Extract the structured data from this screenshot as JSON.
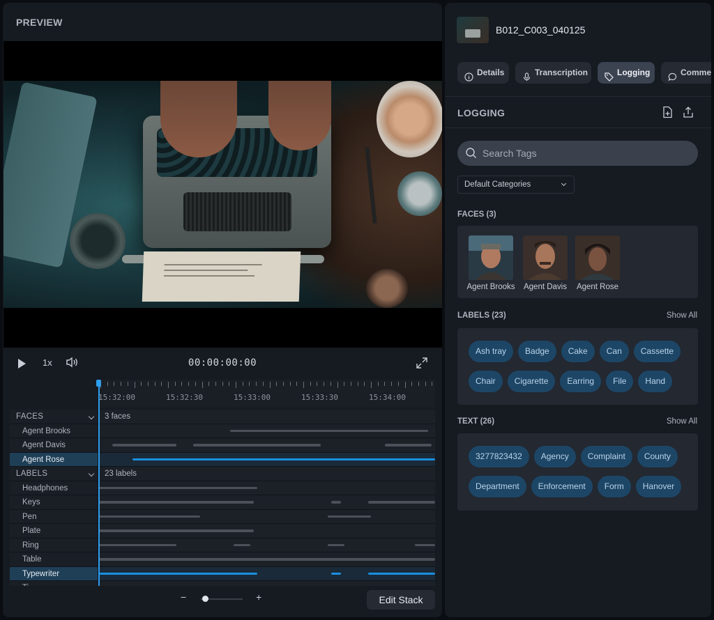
{
  "preview": {
    "title": "PREVIEW",
    "speed": "1x",
    "timecode": "00:00:00:00"
  },
  "timeline": {
    "ruler_labels": [
      "15:32:00",
      "15:32:30",
      "15:33:00",
      "15:33:30",
      "15:34:00"
    ],
    "rows": [
      {
        "type": "group",
        "name": "FACES",
        "count": "3 faces"
      },
      {
        "type": "sub",
        "name": "Agent Brooks",
        "segments": [
          [
            0.39,
            0.98
          ]
        ]
      },
      {
        "type": "sub",
        "name": "Agent Davis",
        "segments": [
          [
            0.04,
            0.23
          ],
          [
            0.28,
            0.66
          ],
          [
            0.85,
            0.99
          ]
        ]
      },
      {
        "type": "sub",
        "name": "Agent Rose",
        "selected": true,
        "segments": [
          [
            0.1,
            1.0
          ]
        ]
      },
      {
        "type": "group",
        "name": "LABELS",
        "count": "23 labels"
      },
      {
        "type": "sub",
        "name": "Headphones",
        "segments": [
          [
            0.0,
            0.47
          ]
        ]
      },
      {
        "type": "sub",
        "name": "Keys",
        "segments": [
          [
            0.0,
            0.46
          ],
          [
            0.69,
            0.72
          ],
          [
            0.8,
            1.0
          ]
        ]
      },
      {
        "type": "sub",
        "name": "Pen",
        "segments": [
          [
            0.0,
            0.3
          ],
          [
            0.68,
            0.81
          ]
        ]
      },
      {
        "type": "sub",
        "name": "Plate",
        "segments": [
          [
            0.0,
            0.46
          ]
        ]
      },
      {
        "type": "sub",
        "name": "Ring",
        "segments": [
          [
            0.0,
            0.23
          ],
          [
            0.4,
            0.45
          ],
          [
            0.68,
            0.73
          ],
          [
            0.94,
            1.0
          ]
        ]
      },
      {
        "type": "sub",
        "name": "Table",
        "segments": [
          [
            0.0,
            1.0
          ]
        ]
      },
      {
        "type": "sub",
        "name": "Typewriter",
        "selected": true,
        "segments": [
          [
            0.0,
            0.47
          ],
          [
            0.69,
            0.72
          ],
          [
            0.8,
            1.0
          ]
        ]
      },
      {
        "type": "sub",
        "name": "Ti...",
        "segments": []
      }
    ]
  },
  "footer": {
    "zoom_minus": "−",
    "zoom_plus": "+",
    "zoom_level": 0.1,
    "edit_stack": "Edit Stack"
  },
  "right": {
    "filename": "B012_C003_040125",
    "tabs": [
      {
        "label": "Details",
        "icon": "info-icon"
      },
      {
        "label": "Transcription",
        "icon": "microphone-icon"
      },
      {
        "label": "Logging",
        "icon": "tag-icon",
        "active": true
      },
      {
        "label": "Comments",
        "icon": "comment-icon"
      }
    ],
    "section_title": "LOGGING",
    "search_placeholder": "Search Tags",
    "category": "Default Categories",
    "faces_title": "FACES (3)",
    "faces": [
      {
        "name": "Agent Brooks"
      },
      {
        "name": "Agent Davis"
      },
      {
        "name": "Agent Rose"
      }
    ],
    "labels_title": "LABELS (23)",
    "labels_showall": "Show All",
    "labels": [
      "Ash tray",
      "Badge",
      "Cake",
      "Can",
      "Cassette",
      "Chair",
      "Cigarette",
      "Earring",
      "File",
      "Hand"
    ],
    "text_title": "TEXT (26)",
    "text_showall": "Show All",
    "text_tags": [
      "3277823432",
      "Agency",
      "Complaint",
      "County",
      "Department",
      "Enforcement",
      "Form",
      "Hanover"
    ]
  },
  "colors": {
    "accent": "#1a8fe0",
    "chip_bg": "#1d4666",
    "panel_bg": "#161a21"
  }
}
